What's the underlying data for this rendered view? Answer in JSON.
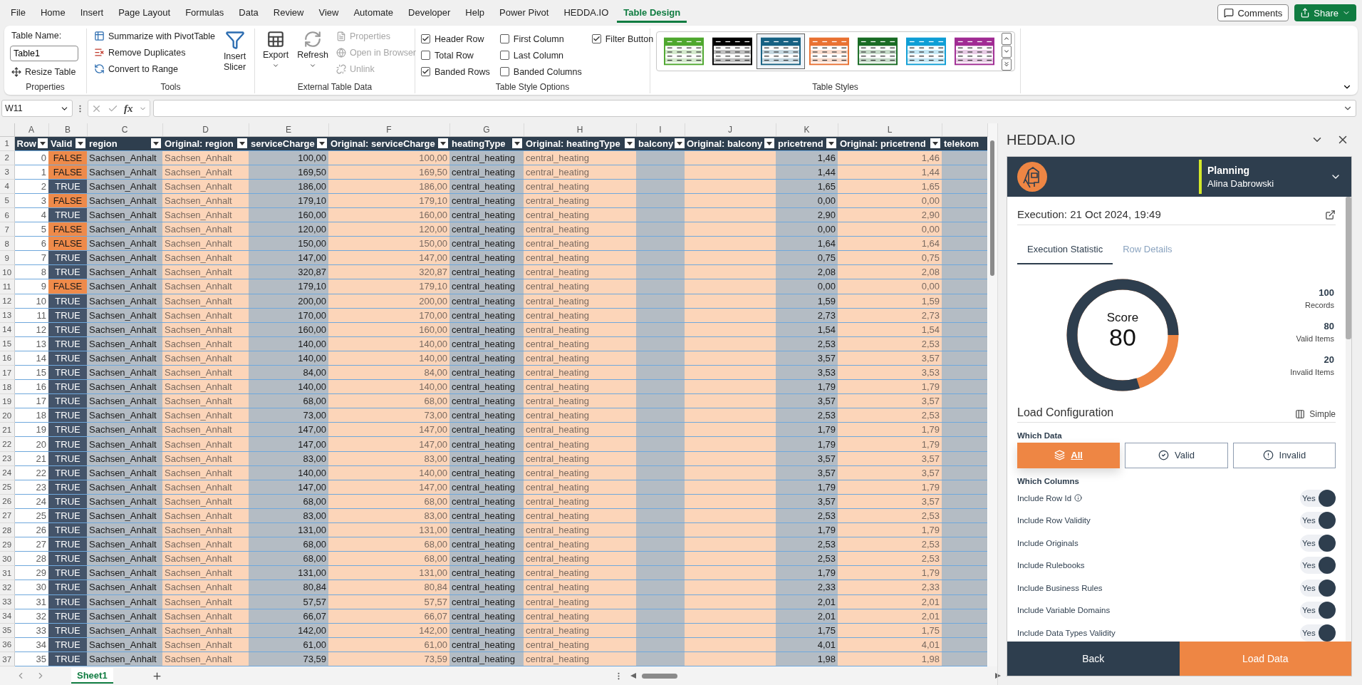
{
  "menu_tabs": [
    {
      "label": "File",
      "selected": false
    },
    {
      "label": "Home",
      "selected": false
    },
    {
      "label": "Insert",
      "selected": false
    },
    {
      "label": "Page Layout",
      "selected": false
    },
    {
      "label": "Formulas",
      "selected": false
    },
    {
      "label": "Data",
      "selected": false
    },
    {
      "label": "Review",
      "selected": false
    },
    {
      "label": "View",
      "selected": false
    },
    {
      "label": "Automate",
      "selected": false
    },
    {
      "label": "Developer",
      "selected": false
    },
    {
      "label": "Help",
      "selected": false
    },
    {
      "label": "Power Pivot",
      "selected": false
    },
    {
      "label": "HEDDA.IO",
      "selected": false
    },
    {
      "label": "Table Design",
      "selected": true
    }
  ],
  "top_buttons": {
    "comments": "Comments",
    "share": "Share"
  },
  "ribbon": {
    "properties": {
      "name_label": "Table Name:",
      "table_name": "Table1",
      "resize": "Resize Table",
      "group": "Properties"
    },
    "tools": {
      "items": [
        "Summarize with PivotTable",
        "Remove Duplicates",
        "Convert to Range"
      ],
      "slicer": "Insert Slicer",
      "group": "Tools"
    },
    "external": {
      "export": "Export",
      "refresh": "Refresh",
      "items": [
        {
          "label": "Properties",
          "disabled": true
        },
        {
          "label": "Open in Browser",
          "disabled": true
        },
        {
          "label": "Unlink",
          "disabled": true
        }
      ],
      "group": "External Table Data"
    },
    "style_options": {
      "options": [
        {
          "label": "Header Row",
          "checked": true
        },
        {
          "label": "Total Row",
          "checked": false
        },
        {
          "label": "Banded Rows",
          "checked": true
        },
        {
          "label": "First Column",
          "checked": false
        },
        {
          "label": "Last Column",
          "checked": false
        },
        {
          "label": "Banded Columns",
          "checked": false
        },
        {
          "label": "Filter Button",
          "checked": true
        }
      ],
      "group": "Table Style Options"
    },
    "table_styles": {
      "swatches": [
        {
          "color": "#4ea72e",
          "selected": false
        },
        {
          "color": "#000000",
          "selected": false
        },
        {
          "color": "#156082",
          "selected": true
        },
        {
          "color": "#e97132",
          "selected": false
        },
        {
          "color": "#196b24",
          "selected": false
        },
        {
          "color": "#0f9ed5",
          "selected": false
        },
        {
          "color": "#a02b93",
          "selected": false
        }
      ],
      "group": "Table Styles"
    }
  },
  "formula_bar": {
    "name_box": "W11",
    "function_label": "fx"
  },
  "sheet": {
    "column_letters": [
      "A",
      "B",
      "C",
      "D",
      "E",
      "F",
      "G",
      "H",
      "I",
      "J",
      "K",
      "L"
    ],
    "header_row_number": "1",
    "columns": [
      {
        "label": "Row",
        "kind": "index",
        "numeric": true
      },
      {
        "label": "Valid",
        "kind": "validity"
      },
      {
        "label": "region",
        "kind": "value",
        "numeric": false
      },
      {
        "label": "Original: region",
        "kind": "original",
        "numeric": false
      },
      {
        "label": "serviceCharge",
        "kind": "value",
        "numeric": true
      },
      {
        "label": "Original: serviceCharge",
        "kind": "original",
        "numeric": true
      },
      {
        "label": "heatingType",
        "kind": "value",
        "numeric": false
      },
      {
        "label": "Original: heatingType",
        "kind": "original",
        "numeric": false
      },
      {
        "label": "balcony",
        "kind": "value"
      },
      {
        "label": "Original: balcony",
        "kind": "original"
      },
      {
        "label": "pricetrend",
        "kind": "value",
        "numeric": true
      },
      {
        "label": "Original: pricetrend",
        "kind": "original",
        "numeric": true
      },
      {
        "label": "telekom",
        "kind": "value"
      }
    ],
    "rows": [
      {
        "number": "2",
        "flagged": true,
        "cells": [
          "0",
          "FALSE",
          "Sachsen_Anhalt",
          "Sachsen_Anhalt",
          "100,00",
          "100,00",
          "central_heating",
          "central_heating",
          null,
          null,
          "1,46",
          "1,46",
          null
        ]
      },
      {
        "number": "3",
        "flagged": true,
        "cells": [
          "1",
          "FALSE",
          "Sachsen_Anhalt",
          "Sachsen_Anhalt",
          "169,50",
          "169,50",
          "central_heating",
          "central_heating",
          null,
          null,
          "1,44",
          "1,44",
          null
        ]
      },
      {
        "number": "4",
        "flagged": false,
        "cells": [
          "2",
          "TRUE",
          "Sachsen_Anhalt",
          "Sachsen_Anhalt",
          "186,00",
          "186,00",
          "central_heating",
          "central_heating",
          null,
          null,
          "1,65",
          "1,65",
          null
        ]
      },
      {
        "number": "5",
        "flagged": true,
        "cells": [
          "3",
          "FALSE",
          "Sachsen_Anhalt",
          "Sachsen_Anhalt",
          "179,10",
          "179,10",
          "central_heating",
          "central_heating",
          null,
          null,
          "0,00",
          "0,00",
          null
        ]
      },
      {
        "number": "6",
        "flagged": false,
        "cells": [
          "4",
          "TRUE",
          "Sachsen_Anhalt",
          "Sachsen_Anhalt",
          "160,00",
          "160,00",
          "central_heating",
          "central_heating",
          null,
          null,
          "2,90",
          "2,90",
          null
        ]
      },
      {
        "number": "7",
        "flagged": true,
        "cells": [
          "5",
          "FALSE",
          "Sachsen_Anhalt",
          "Sachsen_Anhalt",
          "120,00",
          "120,00",
          "central_heating",
          "central_heating",
          null,
          null,
          "0,00",
          "0,00",
          null
        ]
      },
      {
        "number": "8",
        "flagged": true,
        "cells": [
          "6",
          "FALSE",
          "Sachsen_Anhalt",
          "Sachsen_Anhalt",
          "150,00",
          "150,00",
          "central_heating",
          "central_heating",
          null,
          null,
          "1,64",
          "1,64",
          null
        ]
      },
      {
        "number": "9",
        "flagged": false,
        "cells": [
          "7",
          "TRUE",
          "Sachsen_Anhalt",
          "Sachsen_Anhalt",
          "147,00",
          "147,00",
          "central_heating",
          "central_heating",
          null,
          null,
          "0,75",
          "0,75",
          null
        ]
      },
      {
        "number": "10",
        "flagged": false,
        "cells": [
          "8",
          "TRUE",
          "Sachsen_Anhalt",
          "Sachsen_Anhalt",
          "320,87",
          "320,87",
          "central_heating",
          "central_heating",
          null,
          null,
          "2,08",
          "2,08",
          null
        ]
      },
      {
        "number": "11",
        "flagged": true,
        "cells": [
          "9",
          "FALSE",
          "Sachsen_Anhalt",
          "Sachsen_Anhalt",
          "179,10",
          "179,10",
          "central_heating",
          "central_heating",
          null,
          null,
          "0,00",
          "0,00",
          null
        ]
      },
      {
        "number": "12",
        "flagged": false,
        "cells": [
          "10",
          "TRUE",
          "Sachsen_Anhalt",
          "Sachsen_Anhalt",
          "200,00",
          "200,00",
          "central_heating",
          "central_heating",
          null,
          null,
          "1,59",
          "1,59",
          null
        ]
      },
      {
        "number": "13",
        "flagged": false,
        "cells": [
          "11",
          "TRUE",
          "Sachsen_Anhalt",
          "Sachsen_Anhalt",
          "170,00",
          "170,00",
          "central_heating",
          "central_heating",
          null,
          null,
          "2,73",
          "2,73",
          null
        ]
      },
      {
        "number": "14",
        "flagged": false,
        "cells": [
          "12",
          "TRUE",
          "Sachsen_Anhalt",
          "Sachsen_Anhalt",
          "160,00",
          "160,00",
          "central_heating",
          "central_heating",
          null,
          null,
          "1,54",
          "1,54",
          null
        ]
      },
      {
        "number": "15",
        "flagged": false,
        "cells": [
          "13",
          "TRUE",
          "Sachsen_Anhalt",
          "Sachsen_Anhalt",
          "140,00",
          "140,00",
          "central_heating",
          "central_heating",
          null,
          null,
          "2,53",
          "2,53",
          null
        ]
      },
      {
        "number": "16",
        "flagged": false,
        "cells": [
          "14",
          "TRUE",
          "Sachsen_Anhalt",
          "Sachsen_Anhalt",
          "140,00",
          "140,00",
          "central_heating",
          "central_heating",
          null,
          null,
          "3,57",
          "3,57",
          null
        ]
      },
      {
        "number": "17",
        "flagged": false,
        "cells": [
          "15",
          "TRUE",
          "Sachsen_Anhalt",
          "Sachsen_Anhalt",
          "84,00",
          "84,00",
          "central_heating",
          "central_heating",
          null,
          null,
          "3,53",
          "3,53",
          null
        ]
      },
      {
        "number": "18",
        "flagged": false,
        "cells": [
          "16",
          "TRUE",
          "Sachsen_Anhalt",
          "Sachsen_Anhalt",
          "140,00",
          "140,00",
          "central_heating",
          "central_heating",
          null,
          null,
          "1,79",
          "1,79",
          null
        ]
      },
      {
        "number": "19",
        "flagged": false,
        "cells": [
          "17",
          "TRUE",
          "Sachsen_Anhalt",
          "Sachsen_Anhalt",
          "68,00",
          "68,00",
          "central_heating",
          "central_heating",
          null,
          null,
          "3,57",
          "3,57",
          null
        ]
      },
      {
        "number": "20",
        "flagged": false,
        "cells": [
          "18",
          "TRUE",
          "Sachsen_Anhalt",
          "Sachsen_Anhalt",
          "73,00",
          "73,00",
          "central_heating",
          "central_heating",
          null,
          null,
          "2,53",
          "2,53",
          null
        ]
      },
      {
        "number": "21",
        "flagged": false,
        "cells": [
          "19",
          "TRUE",
          "Sachsen_Anhalt",
          "Sachsen_Anhalt",
          "147,00",
          "147,00",
          "central_heating",
          "central_heating",
          null,
          null,
          "1,79",
          "1,79",
          null
        ]
      },
      {
        "number": "22",
        "flagged": false,
        "cells": [
          "20",
          "TRUE",
          "Sachsen_Anhalt",
          "Sachsen_Anhalt",
          "147,00",
          "147,00",
          "central_heating",
          "central_heating",
          null,
          null,
          "1,79",
          "1,79",
          null
        ]
      },
      {
        "number": "23",
        "flagged": false,
        "cells": [
          "21",
          "TRUE",
          "Sachsen_Anhalt",
          "Sachsen_Anhalt",
          "83,00",
          "83,00",
          "central_heating",
          "central_heating",
          null,
          null,
          "3,57",
          "3,57",
          null
        ]
      },
      {
        "number": "24",
        "flagged": false,
        "cells": [
          "22",
          "TRUE",
          "Sachsen_Anhalt",
          "Sachsen_Anhalt",
          "140,00",
          "140,00",
          "central_heating",
          "central_heating",
          null,
          null,
          "3,57",
          "3,57",
          null
        ]
      },
      {
        "number": "25",
        "flagged": false,
        "cells": [
          "23",
          "TRUE",
          "Sachsen_Anhalt",
          "Sachsen_Anhalt",
          "147,00",
          "147,00",
          "central_heating",
          "central_heating",
          null,
          null,
          "1,79",
          "1,79",
          null
        ]
      },
      {
        "number": "26",
        "flagged": false,
        "cells": [
          "24",
          "TRUE",
          "Sachsen_Anhalt",
          "Sachsen_Anhalt",
          "68,00",
          "68,00",
          "central_heating",
          "central_heating",
          null,
          null,
          "3,57",
          "3,57",
          null
        ]
      },
      {
        "number": "27",
        "flagged": false,
        "cells": [
          "25",
          "TRUE",
          "Sachsen_Anhalt",
          "Sachsen_Anhalt",
          "83,00",
          "83,00",
          "central_heating",
          "central_heating",
          null,
          null,
          "2,53",
          "2,53",
          null
        ]
      },
      {
        "number": "28",
        "flagged": false,
        "cells": [
          "26",
          "TRUE",
          "Sachsen_Anhalt",
          "Sachsen_Anhalt",
          "131,00",
          "131,00",
          "central_heating",
          "central_heating",
          null,
          null,
          "1,79",
          "1,79",
          null
        ]
      },
      {
        "number": "29",
        "flagged": false,
        "cells": [
          "27",
          "TRUE",
          "Sachsen_Anhalt",
          "Sachsen_Anhalt",
          "68,00",
          "68,00",
          "central_heating",
          "central_heating",
          null,
          null,
          "2,53",
          "2,53",
          null
        ]
      },
      {
        "number": "30",
        "flagged": false,
        "cells": [
          "28",
          "TRUE",
          "Sachsen_Anhalt",
          "Sachsen_Anhalt",
          "68,00",
          "68,00",
          "central_heating",
          "central_heating",
          null,
          null,
          "2,53",
          "2,53",
          null
        ]
      },
      {
        "number": "31",
        "flagged": false,
        "cells": [
          "29",
          "TRUE",
          "Sachsen_Anhalt",
          "Sachsen_Anhalt",
          "131,00",
          "131,00",
          "central_heating",
          "central_heating",
          null,
          null,
          "1,79",
          "1,79",
          null
        ]
      },
      {
        "number": "32",
        "flagged": false,
        "cells": [
          "30",
          "TRUE",
          "Sachsen_Anhalt",
          "Sachsen_Anhalt",
          "80,84",
          "80,84",
          "central_heating",
          "central_heating",
          null,
          null,
          "2,33",
          "2,33",
          null
        ]
      },
      {
        "number": "33",
        "flagged": false,
        "cells": [
          "31",
          "TRUE",
          "Sachsen_Anhalt",
          "Sachsen_Anhalt",
          "57,57",
          "57,57",
          "central_heating",
          "central_heating",
          null,
          null,
          "2,01",
          "2,01",
          null
        ]
      },
      {
        "number": "34",
        "flagged": false,
        "cells": [
          "32",
          "TRUE",
          "Sachsen_Anhalt",
          "Sachsen_Anhalt",
          "66,07",
          "66,07",
          "central_heating",
          "central_heating",
          null,
          null,
          "2,01",
          "2,01",
          null
        ]
      },
      {
        "number": "35",
        "flagged": false,
        "cells": [
          "33",
          "TRUE",
          "Sachsen_Anhalt",
          "Sachsen_Anhalt",
          "142,00",
          "142,00",
          "central_heating",
          "central_heating",
          null,
          null,
          "1,75",
          "1,75",
          null
        ]
      },
      {
        "number": "36",
        "flagged": false,
        "cells": [
          "34",
          "TRUE",
          "Sachsen_Anhalt",
          "Sachsen_Anhalt",
          "61,00",
          "61,00",
          "central_heating",
          "central_heating",
          null,
          null,
          "4,01",
          "4,01",
          null
        ]
      },
      {
        "number": "37",
        "flagged": false,
        "cells": [
          "35",
          "TRUE",
          "Sachsen_Anhalt",
          "Sachsen_Anhalt",
          "73,59",
          "73,59",
          "central_heating",
          "central_heating",
          null,
          null,
          "1,98",
          "1,98",
          null
        ]
      }
    ],
    "tabs": [
      {
        "label": "Sheet1",
        "selected": true
      }
    ]
  },
  "pane": {
    "title": "HEDDA.IO",
    "workspace": "Planning",
    "user": "Alina Dabrowski",
    "execution": "Execution: 21 Oct 2024, 19:49",
    "tabs": [
      {
        "label": "Execution Statistic",
        "selected": true
      },
      {
        "label": "Row Details",
        "selected": false
      }
    ],
    "score": {
      "label": "Score",
      "value": "80",
      "level": 0.8
    },
    "stats": [
      {
        "value": "100",
        "label": "Records"
      },
      {
        "value": "80",
        "label": "Valid Items"
      },
      {
        "value": "20",
        "label": "Invalid Items"
      }
    ],
    "load_config": {
      "title": "Load Configuration",
      "mode": "Simple",
      "which_data": "Which Data",
      "data_options": [
        {
          "label": "All",
          "kind": "all",
          "selected": true
        },
        {
          "label": "Valid",
          "kind": "valid",
          "selected": false
        },
        {
          "label": "Invalid",
          "kind": "invalid",
          "selected": false
        }
      ],
      "which_columns": "Which Columns",
      "toggles": [
        {
          "label": "Include Row Id",
          "state": "Yes",
          "on": true,
          "info": true
        },
        {
          "label": "Include Row Validity",
          "state": "Yes",
          "on": true,
          "info": false
        },
        {
          "label": "Include Originals",
          "state": "Yes",
          "on": true,
          "info": false
        },
        {
          "label": "Include Rulebooks",
          "state": "Yes",
          "on": true,
          "info": false
        },
        {
          "label": "Include Business Rules",
          "state": "Yes",
          "on": true,
          "info": false
        },
        {
          "label": "Include Variable Domains",
          "state": "Yes",
          "on": true,
          "info": false
        },
        {
          "label": "Include Data Types Validity",
          "state": "Yes",
          "on": true,
          "info": false
        }
      ]
    },
    "back": "Back",
    "load": "Load Data"
  }
}
